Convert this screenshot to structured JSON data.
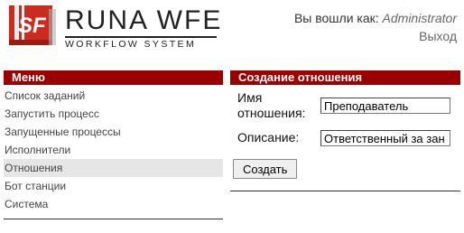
{
  "logo": {
    "mark": "SF",
    "name": "RUNA WFE",
    "subtitle": "WORKFLOW SYSTEM"
  },
  "header": {
    "logged_in_prefix": "Вы вошли как:",
    "user": "Administrator",
    "logout_label": "Выход"
  },
  "menu": {
    "title": "Меню",
    "items": [
      {
        "label": "Список заданий"
      },
      {
        "label": "Запустить процесс"
      },
      {
        "label": "Запущенные процессы"
      },
      {
        "label": "Исполнители"
      },
      {
        "label": "Отношения"
      },
      {
        "label": "Бот станции"
      },
      {
        "label": "Система"
      }
    ],
    "active_index": 4
  },
  "form": {
    "title": "Создание отношения",
    "name_label_line1": "Имя",
    "name_label_line2": "отношения:",
    "name_value": "Преподаватель",
    "description_label": "Описание:",
    "description_value": "Ответственный за зан",
    "submit_label": "Создать"
  },
  "colors": {
    "accent": "#990000",
    "active_item_bg": "#e6e6e6"
  }
}
